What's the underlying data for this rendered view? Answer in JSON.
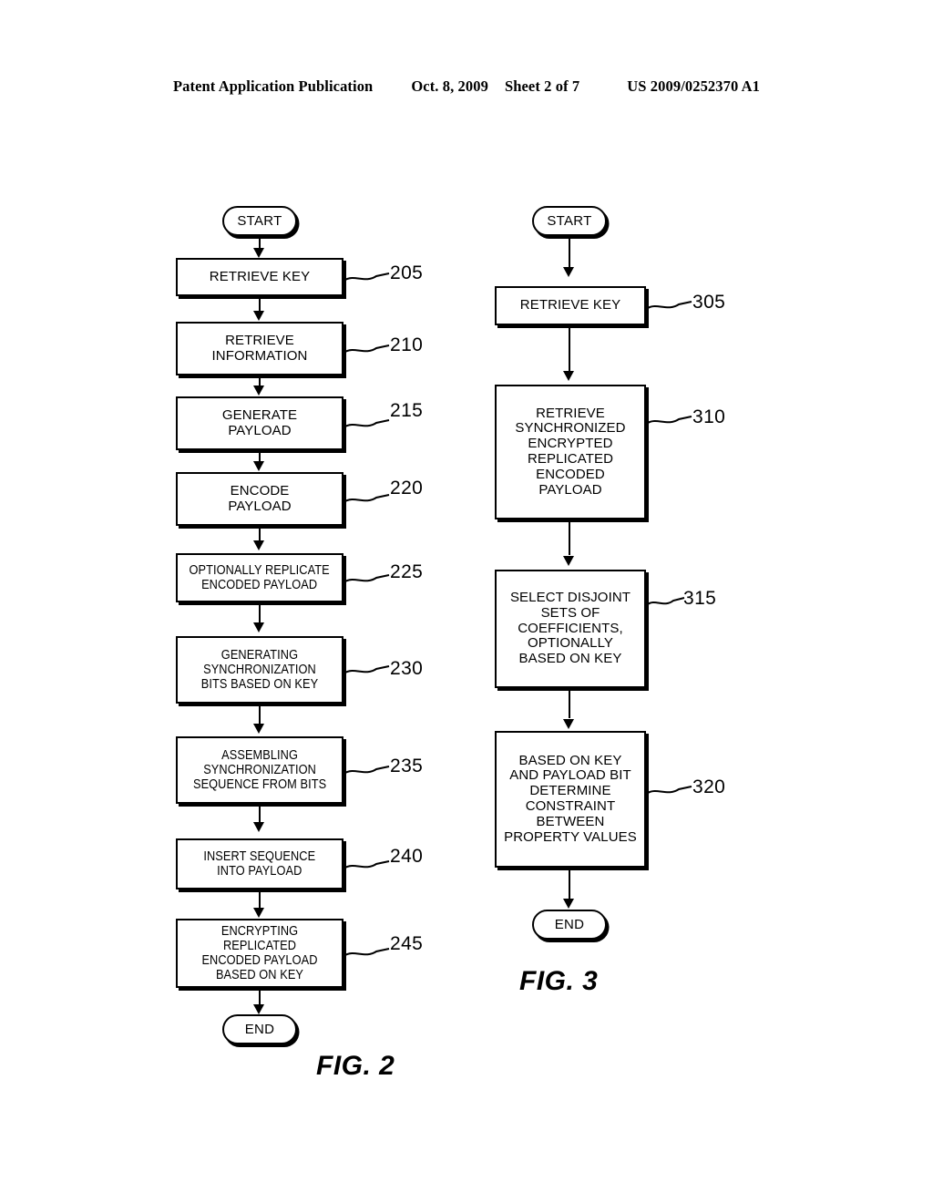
{
  "header": {
    "publication": "Patent Application Publication",
    "date": "Oct. 8, 2009",
    "sheet": "Sheet 2 of 7",
    "docnumber": "US 2009/0252370 A1"
  },
  "figures": [
    {
      "id": "fig2",
      "label": "FIG. 2",
      "start_label": "START",
      "end_label": "END",
      "steps": [
        {
          "ref": "205",
          "text": "RETRIEVE KEY"
        },
        {
          "ref": "210",
          "text": "RETRIEVE\nINFORMATION"
        },
        {
          "ref": "215",
          "text": "GENERATE\nPAYLOAD"
        },
        {
          "ref": "220",
          "text": "ENCODE\nPAYLOAD"
        },
        {
          "ref": "225",
          "text": "OPTIONALLY REPLICATE\nENCODED PAYLOAD"
        },
        {
          "ref": "230",
          "text": "GENERATING\nSYNCHRONIZATION\nBITS BASED ON KEY"
        },
        {
          "ref": "235",
          "text": "ASSEMBLING\nSYNCHRONIZATION\nSEQUENCE FROM BITS"
        },
        {
          "ref": "240",
          "text": "INSERT SEQUENCE\nINTO PAYLOAD"
        },
        {
          "ref": "245",
          "text": "ENCRYPTING REPLICATED\nENCODED PAYLOAD\nBASED ON KEY"
        }
      ]
    },
    {
      "id": "fig3",
      "label": "FIG. 3",
      "start_label": "START",
      "end_label": "END",
      "steps": [
        {
          "ref": "305",
          "text": "RETRIEVE KEY"
        },
        {
          "ref": "310",
          "text": "RETRIEVE\nSYNCHRONIZED\nENCRYPTED\nREPLICATED\nENCODED\nPAYLOAD"
        },
        {
          "ref": "315",
          "text": "SELECT DISJOINT\nSETS OF\nCOEFFICIENTS,\nOPTIONALLY\nBASED ON KEY"
        },
        {
          "ref": "320",
          "text": "BASED ON KEY\nAND PAYLOAD BIT\nDETERMINE\nCONSTRAINT\nBETWEEN\nPROPERTY VALUES"
        }
      ]
    }
  ],
  "colors": {
    "ink": "#000000",
    "paper": "#ffffff"
  }
}
